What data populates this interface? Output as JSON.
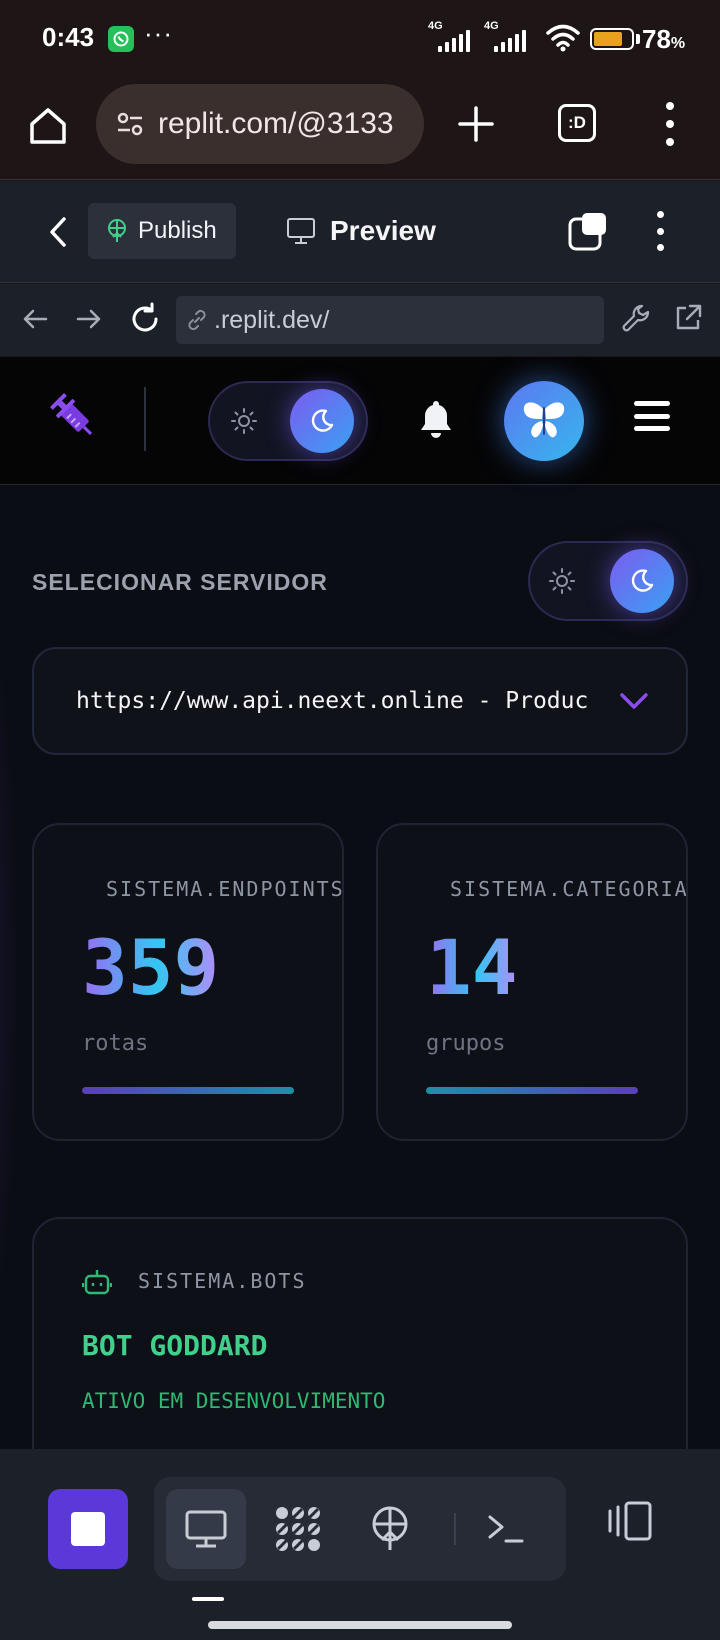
{
  "status_bar": {
    "time": "0:43",
    "dots": "···",
    "network_1": "4G",
    "network_2": "4G",
    "battery_percent": "78",
    "battery_symbol": "%",
    "battery_level": 0.78,
    "battery_color": "#e9a21e"
  },
  "browser": {
    "url": "replit.com/@3133",
    "tabs_label": ":D"
  },
  "replit_toolbar": {
    "publish_label": "Publish",
    "preview_label": "Preview",
    "address": ".replit.dev/"
  },
  "app": {
    "server_label": "SELECIONAR SERVIDOR",
    "server_value": "https://www.api.neext.online - Production",
    "stats": [
      {
        "title": "SISTEMA.ENDPOINTS",
        "value": "359",
        "unit": "rotas"
      },
      {
        "title": "SISTEMA.CATEGORIAS",
        "value": "14",
        "unit": "grupos"
      }
    ],
    "bot": {
      "title": "SISTEMA.BOTS",
      "name": "BOT GODDARD",
      "status": "ATIVO EM DESENVOLVIMENTO"
    },
    "accent_color": "#6d5cf0"
  },
  "icons": [
    "home-icon",
    "tune-icon",
    "plus-icon",
    "syringe-icon",
    "sun-icon",
    "moon-icon",
    "bell-icon",
    "butterfly-icon",
    "menu-icon",
    "chevron-down-icon",
    "robot-icon",
    "monitor-icon",
    "terminal-icon"
  ]
}
